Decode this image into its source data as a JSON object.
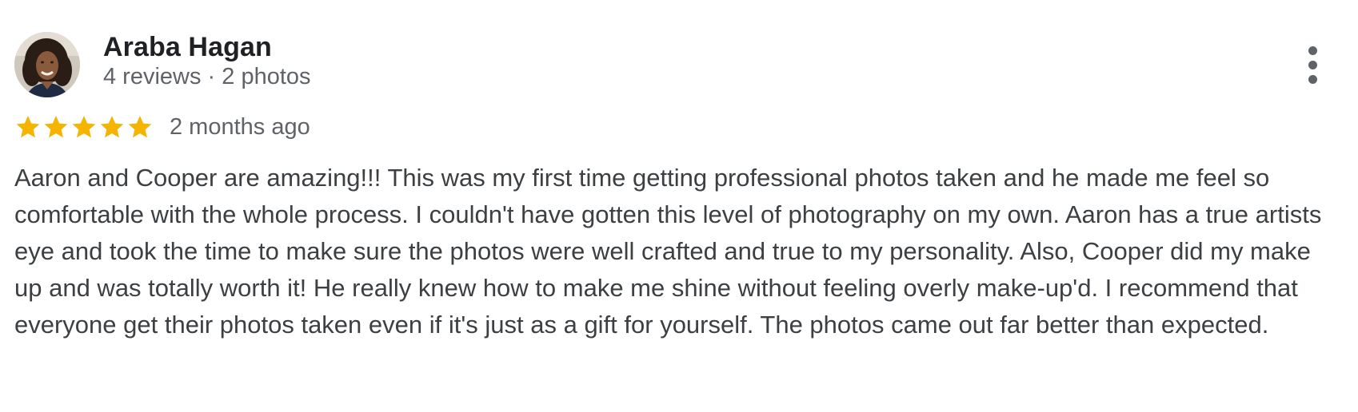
{
  "review": {
    "author": {
      "name": "Araba Hagan",
      "meta": "4 reviews · 2 photos",
      "avatar_icon": "person-avatar-photo"
    },
    "menu_icon": "more-vert-icon",
    "rating": {
      "stars": 5,
      "max_stars": 5,
      "star_icon": "star-icon",
      "star_color": "#F4B400"
    },
    "date": "2 months ago",
    "text": "Aaron and Cooper are amazing!!! This was my first time getting professional photos taken and he made me feel so comfortable with the whole process. I couldn't have gotten this level of photography on my own. Aaron has a true artists eye and took the time to make sure the photos were well crafted and true to my personality. Also, Cooper did my make up and was totally worth it! He really knew how to make me shine without feeling overly make-up'd. I recommend that everyone get their photos taken even if it's just as a gift for yourself. The photos came out far better than expected."
  },
  "colors": {
    "name": "#202124",
    "secondary_text": "#5F6368",
    "body_text": "#3C4043",
    "star": "#F4B400"
  }
}
